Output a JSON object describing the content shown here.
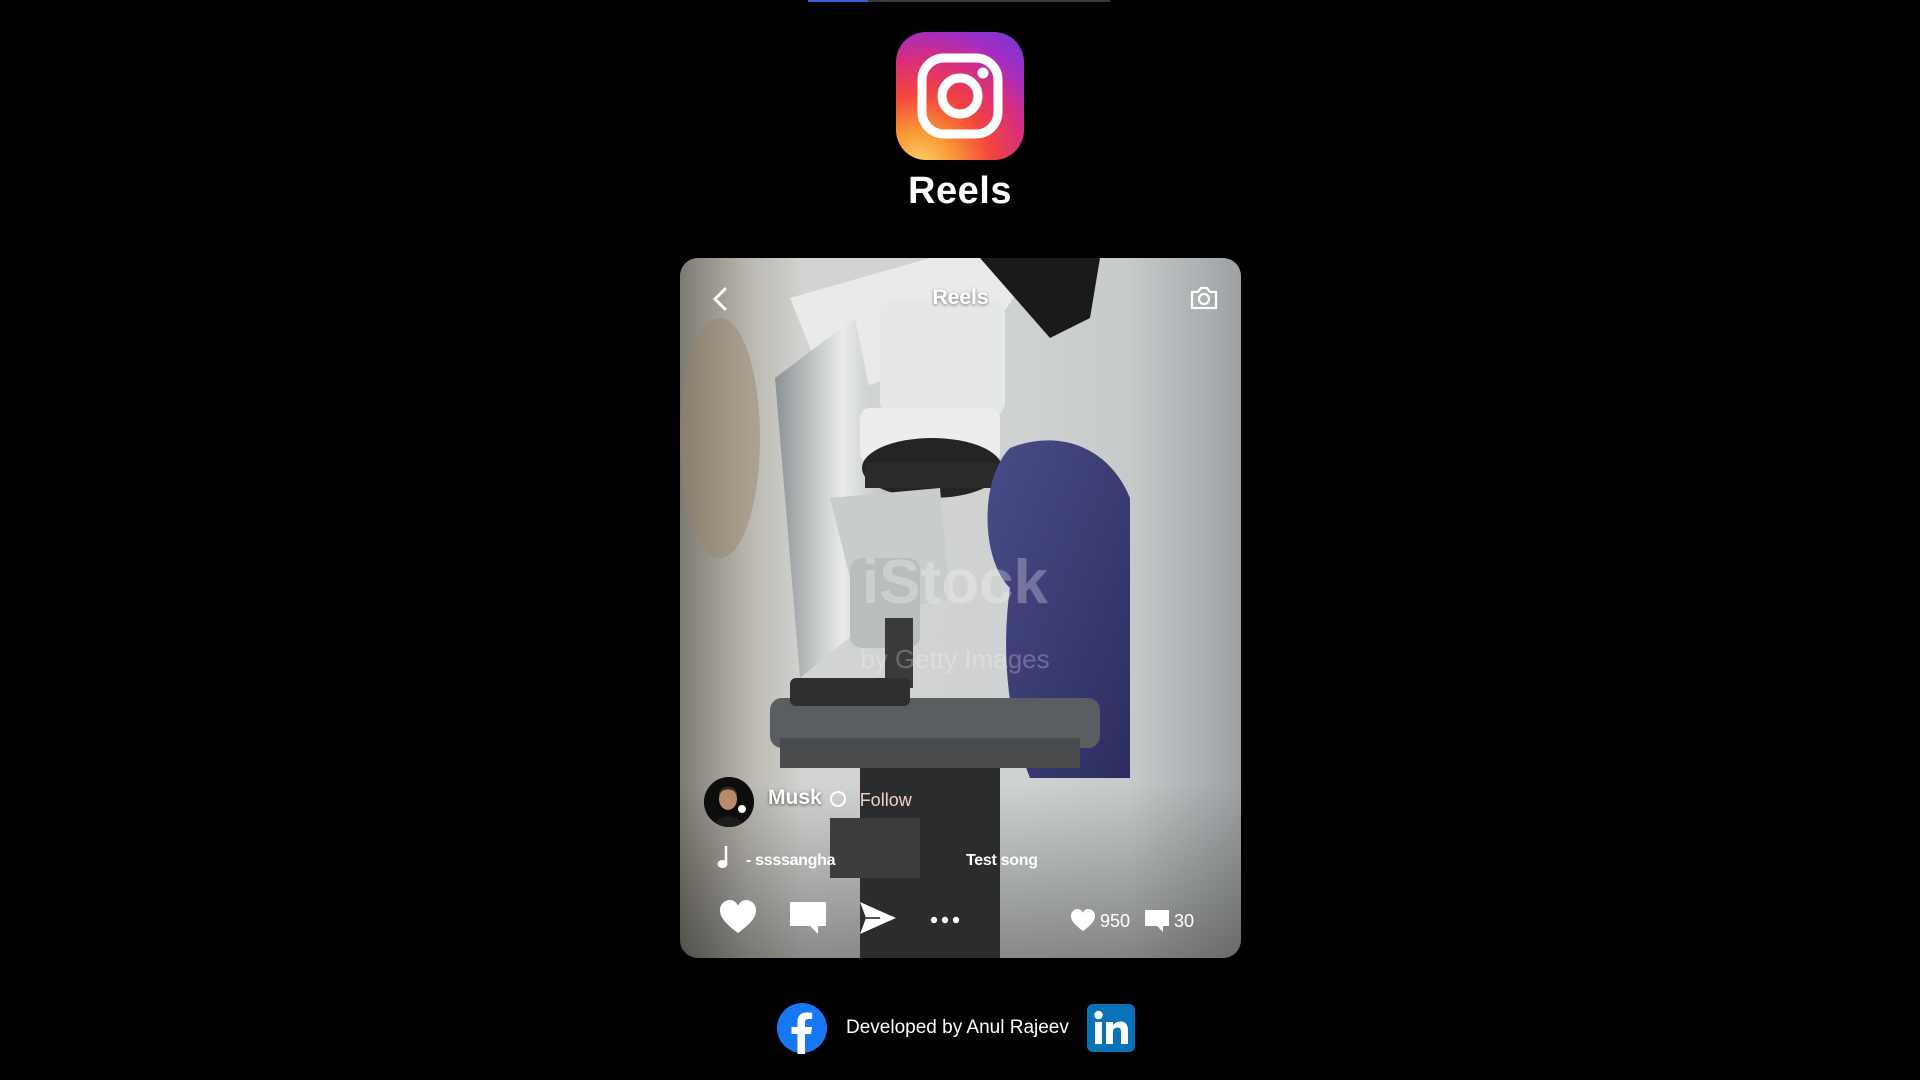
{
  "progress": {
    "fraction": 0.2,
    "track_color": "#3a3a3a",
    "fill_color": "#2f5fd0"
  },
  "header": {
    "logo_icon": "instagram-logo-icon",
    "title": "Reels"
  },
  "reel": {
    "title": "Reels",
    "back_icon": "chevron-left-icon",
    "camera_icon": "camera-icon",
    "user": {
      "name": "Musk",
      "follow_label": "Follow",
      "avatar_icon": "avatar-icon"
    },
    "music": {
      "artist": "- ssssangha",
      "song": "Test song",
      "icon": "music-note-icon"
    },
    "actions": [
      "heart-icon",
      "comment-icon",
      "send-icon",
      "more-icon"
    ],
    "stats": {
      "likes": "950",
      "comments": "30"
    }
  },
  "footer": {
    "credit": "Developed by Anul Rajeev",
    "left_icon": "facebook-icon",
    "right_icon": "linkedin-icon"
  },
  "colors": {
    "background": "#000000",
    "follow": "#f3d0c8",
    "linkedin": "#0a73b7",
    "facebook": "#1877f2"
  }
}
